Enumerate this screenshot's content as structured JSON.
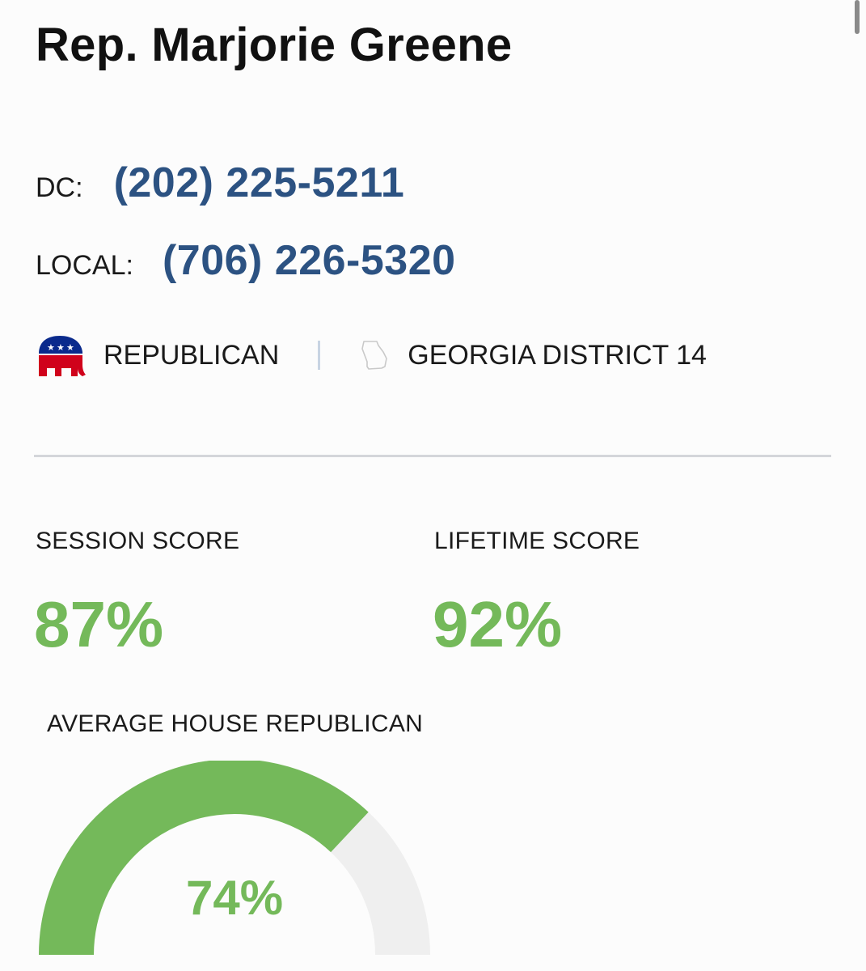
{
  "representative": {
    "name": "Rep. Marjorie Greene"
  },
  "contact": {
    "dc": {
      "label": "DC:",
      "phone": "(202) 225-5211"
    },
    "local": {
      "label": "LOCAL:",
      "phone": "(706) 226-5320"
    }
  },
  "affiliation": {
    "party_icon": "republican-elephant-icon",
    "party": "REPUBLICAN",
    "state_icon": "georgia-outline-icon",
    "district": "GEORGIA DISTRICT 14"
  },
  "scores": {
    "session": {
      "label": "SESSION SCORE",
      "value": "87%"
    },
    "lifetime": {
      "label": "LIFETIME SCORE",
      "value": "92%"
    }
  },
  "average": {
    "label": "AVERAGE HOUSE REPUBLICAN",
    "value": "74%",
    "fraction": 0.74
  },
  "colors": {
    "phone_blue": "#2c5282",
    "score_green": "#74b95a",
    "gauge_track": "#efefef",
    "republican_red": "#d0021b",
    "republican_blue": "#0a2a8c"
  }
}
